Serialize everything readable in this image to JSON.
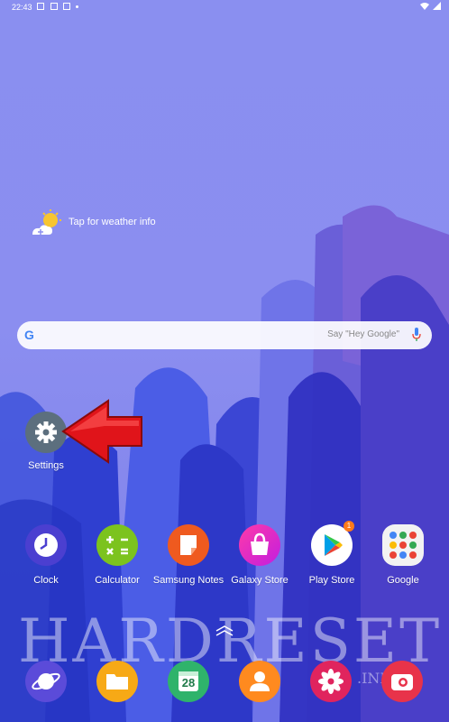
{
  "status_bar": {
    "time": "22:43"
  },
  "weather": {
    "label": "Tap for weather info"
  },
  "search": {
    "placeholder": "Say \"Hey Google\"",
    "google_letter": "G"
  },
  "settings_app": {
    "label": "Settings"
  },
  "apps": [
    {
      "label": "Clock"
    },
    {
      "label": "Calculator"
    },
    {
      "label": "Samsung Notes"
    },
    {
      "label": "Galaxy Store"
    },
    {
      "label": "Play Store",
      "badge": "1"
    },
    {
      "label": "Google"
    }
  ],
  "dock": {
    "calendar_day": "28"
  },
  "watermark": {
    "main": "HARDRESET",
    "suffix": ".INFO"
  },
  "colors": {
    "wallpaper": "#8a8ff0",
    "settings": "#5c6f7e",
    "arrow": "#e0141a"
  }
}
